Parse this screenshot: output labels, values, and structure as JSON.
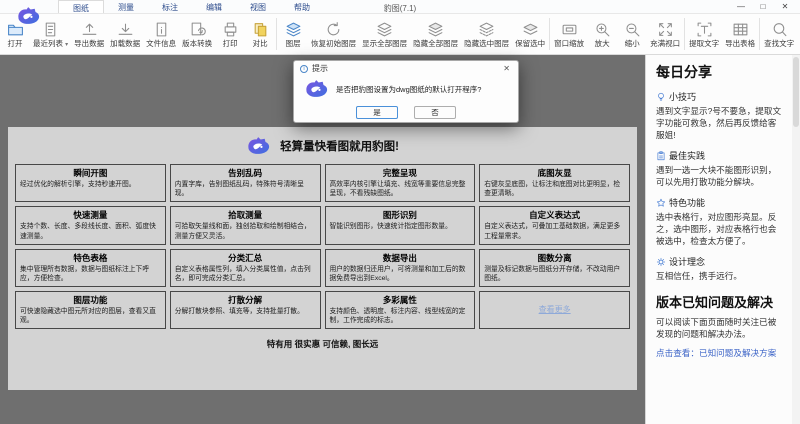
{
  "window": {
    "title": "豹图(7.1)"
  },
  "icons": {
    "minimize": "—",
    "maximize": "□",
    "close": "✕",
    "dropdown": "▾",
    "info": "i"
  },
  "menu": {
    "tabs": [
      {
        "label": "图纸"
      },
      {
        "label": "测量"
      },
      {
        "label": "标注"
      },
      {
        "label": "编辑"
      },
      {
        "label": "视图"
      },
      {
        "label": "帮助"
      }
    ]
  },
  "toolbar": {
    "items": [
      "打开",
      "最近列表",
      "导出数据",
      "加载数据",
      "文件信息",
      "版本转换",
      "打印",
      "对比",
      "图层",
      "恢复初始图层",
      "显示全部图层",
      "隐藏全部图层",
      "隐藏选中图层",
      "保留选中",
      "窗口缩放",
      "放大",
      "缩小",
      "充满视口",
      "提取文字",
      "导出表格",
      "查找文字"
    ]
  },
  "dialog": {
    "title": "提示",
    "message": "是否把豹图设置为dwg图纸的默认打开程序?",
    "yes_label": "是",
    "no_label": "否"
  },
  "panel": {
    "headline": "轻算量快看图就用豹图!",
    "tagline": "特有用 很实惠 可信赖, 图长远",
    "more_link": "查看更多",
    "features": [
      {
        "title": "瞬间开图",
        "desc": "经过优化的解析引擎，支持秒速开图。"
      },
      {
        "title": "告别乱码",
        "desc": "内置字库，告别图纸乱码，特殊符号清晰呈现。"
      },
      {
        "title": "完整呈现",
        "desc": "高效率内核引擎让填充、线宽等重要信息完整呈现，不看残缺图纸。"
      },
      {
        "title": "底图灰显",
        "desc": "右键灰显底图，让标注和底图对比更明显，检查更清晰。"
      },
      {
        "title": "快速测量",
        "desc": "支持个数、长度、多段线长度、面积、弧度快速测量。"
      },
      {
        "title": "拾取测量",
        "desc": "可拾取矢量线和面，独创拾取和绘制相结合，测量方便又灵活。"
      },
      {
        "title": "图形识别",
        "desc": "智能识别图形，快速统计指定图形数量。"
      },
      {
        "title": "自定义表达式",
        "desc": "自定义表达式，可叠加工基础数据，满足更多工程量需求。"
      },
      {
        "title": "特色表格",
        "desc": "集中管理所有数据，数据与图纸标注上下呼应，方便检查。"
      },
      {
        "title": "分类汇总",
        "desc": "自定义表格属性列，填入分类属性值，点击列名，即可完成分类汇总。"
      },
      {
        "title": "数据导出",
        "desc": "用户的数据归还用户，可将测量和加工后的数据免费导出到Excel。"
      },
      {
        "title": "图数分离",
        "desc": "测量及标记数据与图纸分开存储，不改动用户图纸。"
      },
      {
        "title": "图层功能",
        "desc": "可快速隐藏选中图元所对应的图层，查看又直观。"
      },
      {
        "title": "打散分解",
        "desc": "分解打散块参照、填充等，支持批量打散。"
      },
      {
        "title": "多彩属性",
        "desc": "支持颜色、透明度、标注内容、线型线宽的定制，工作完成的标志。"
      }
    ]
  },
  "sidebar": {
    "title": "每日分享",
    "sections": [
      {
        "title": "小技巧",
        "text": "遇到文字显示?号不要急，提取文字功能可救急，然后再反馈给客服姐!"
      },
      {
        "title": "最佳实践",
        "text": "遇到一选一大块不能图形识别，可以先用打散功能分解块。"
      },
      {
        "title": "特色功能",
        "text": "选中表格行，对应图形亮显。反之，选中图形，对应表格行也会被选中，检查太方便了。"
      },
      {
        "title": "设计理念",
        "text": "互相信任，携手远行。"
      }
    ],
    "issues_title": "版本已知问题及解决",
    "issues_text": "可以阅读下面页面随时关注已被发现的问题和解决办法。",
    "issues_link_prefix": "点击查看：",
    "issues_link": "已知问题及解决方案"
  }
}
